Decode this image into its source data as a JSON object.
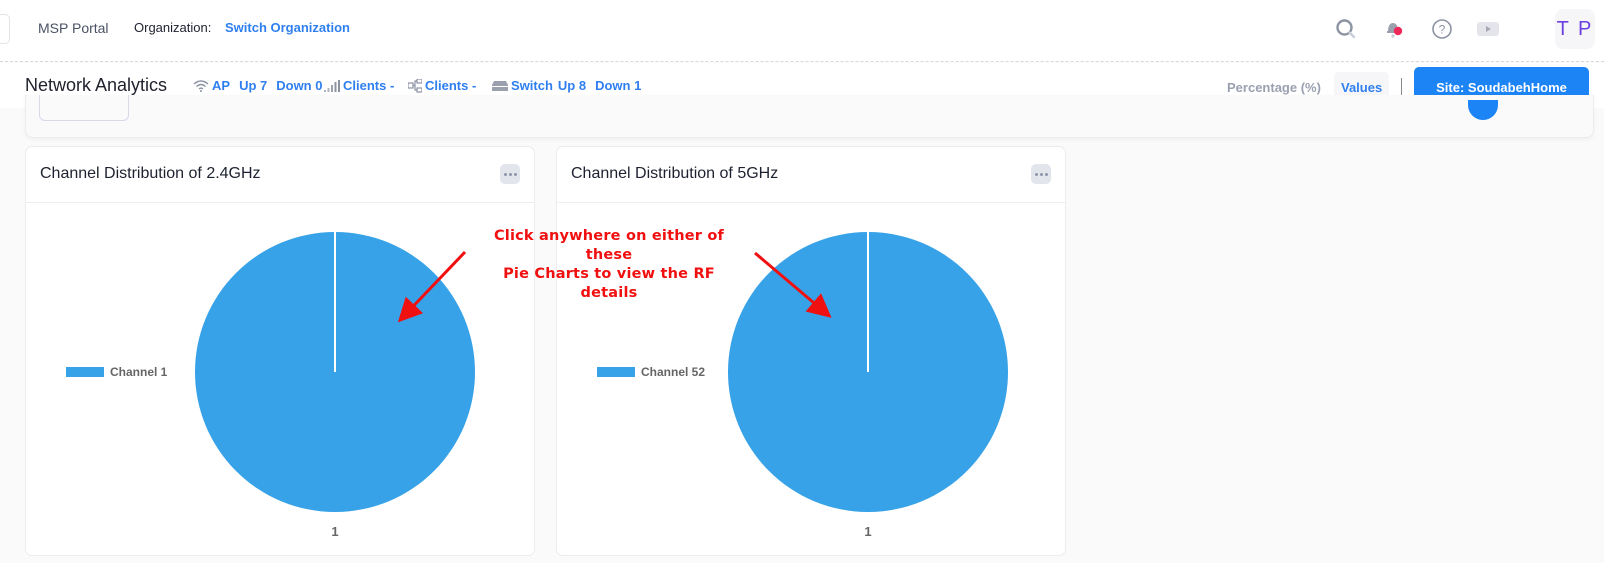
{
  "topbar": {
    "brand": "MSP Portal",
    "org_label": "Organization:",
    "org_link": "Switch Organization",
    "icons": [
      "search-icon",
      "notification-bell-icon",
      "help-icon",
      "video-play-icon"
    ],
    "avatar_initials": "T P",
    "notification_dot_color": "#f0285a"
  },
  "subbar": {
    "title": "Network Analytics",
    "stats": {
      "ap_label": "AP",
      "ap_up": "Up 7",
      "ap_down": "Down 0",
      "wireless_clients": "Clients -",
      "wired_clients": "Clients -",
      "switch_label": "Switch",
      "switch_up": "Up 8",
      "switch_down": "Down 1"
    },
    "mode_options": [
      "Percentage (%)",
      "Values"
    ],
    "mode_selected": "Values",
    "site_button": "Site: SoudabehHome"
  },
  "annotation": {
    "text_line1": "Click anywhere on either of these",
    "text_line2": "Pie Charts to view the RF details",
    "color": "#f01010"
  },
  "chart_data": [
    {
      "type": "pie",
      "title": "Channel Distribution of 2.4GHz",
      "categories": [
        "Channel 1"
      ],
      "values": [
        1
      ],
      "data_labels": [
        "1"
      ],
      "colors": [
        "#37a2e8"
      ],
      "legend": "left"
    },
    {
      "type": "pie",
      "title": "Channel Distribution of 5GHz",
      "categories": [
        "Channel 52"
      ],
      "values": [
        1
      ],
      "data_labels": [
        "1"
      ],
      "colors": [
        "#37a2e8"
      ],
      "legend": "left"
    }
  ]
}
